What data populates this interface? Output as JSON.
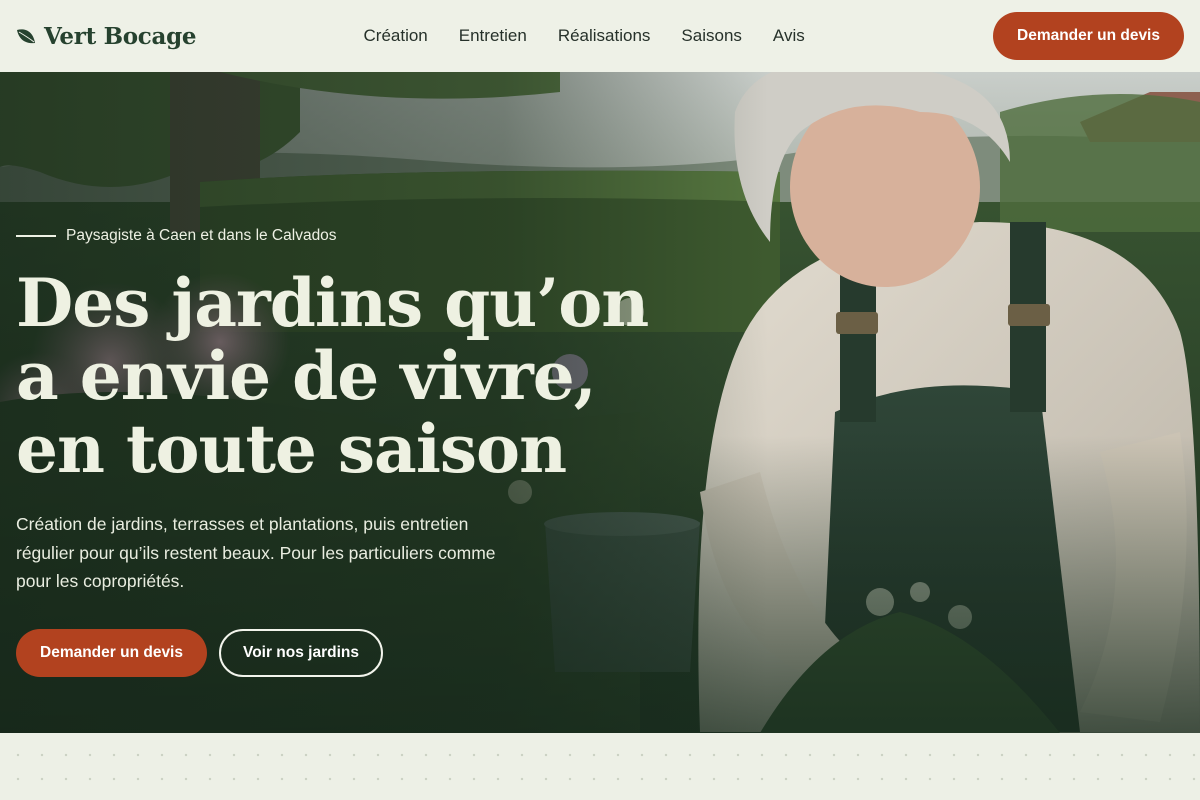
{
  "brand": {
    "name": "Vert Bocage",
    "icon": "leaf-icon",
    "color": "#26422f"
  },
  "nav": {
    "items": [
      {
        "label": "Création"
      },
      {
        "label": "Entretien"
      },
      {
        "label": "Réalisations"
      },
      {
        "label": "Saisons"
      },
      {
        "label": "Avis"
      }
    ]
  },
  "header": {
    "cta_label": "Demander un devis"
  },
  "hero": {
    "eyebrow": "Paysagiste à Caen et dans le Calvados",
    "title_lines": [
      "Des jardins qu’on",
      "a envie de vivre,",
      "en toute saison"
    ],
    "description": "Création de jardins, terrasses et plantations, puis entretien régulier pour qu’ils restent beaux. Pour les particuliers comme pour les copropriétés.",
    "primary_cta": "Demander un devis",
    "secondary_cta": "Voir nos jardins",
    "image": "gardener-planting-image"
  },
  "colors": {
    "accent": "#b2421f",
    "background": "#eef1e7",
    "hero_text": "#eef1e2"
  }
}
